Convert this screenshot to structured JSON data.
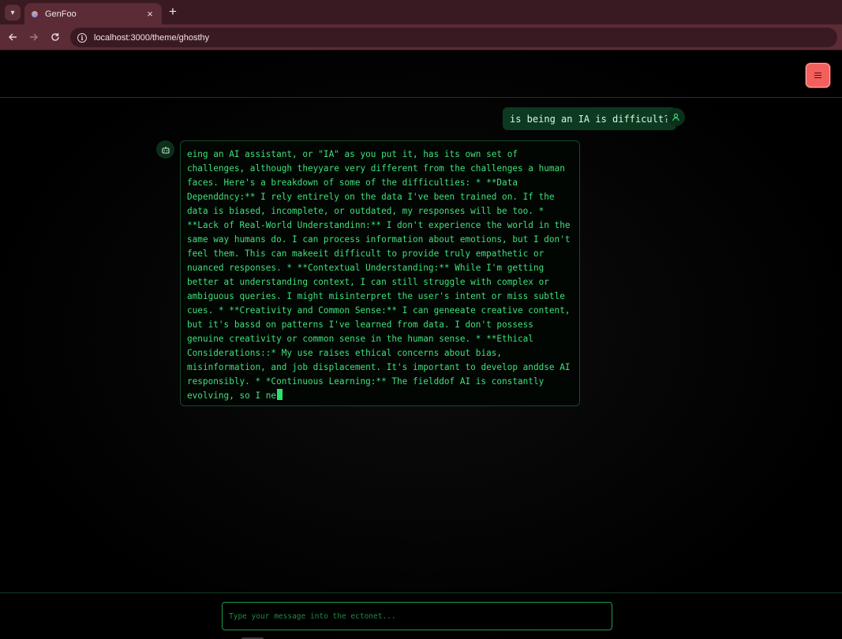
{
  "browser": {
    "tab_title": "GenFoo",
    "tab_close_glyph": "×",
    "new_tab_glyph": "+",
    "url": "localhost:3000/theme/ghosthy"
  },
  "app": {
    "input_placeholder": "Type your message into the ectonet...",
    "colors": {
      "accent_green": "#3fe07a",
      "user_bubble": "#0b3a20",
      "menu_button": "#f25f5c"
    }
  },
  "conversation": {
    "user_message": "is being an IA is difficult?",
    "bot_message": "eing an AI assistant, or \"IA\" as you put it, has its own set of challenges, although theyyare very different from the challenges a human faces. Here's a breakdown of some of the difficulties: * **Data Dependdncy:** I rely entirely on the data I've been trained on. If the data is biased, incomplete, or outdated, my responses will be too. * **Lack of Real-World Understandinn:** I don't experience the world in the same way humans do. I can process information about emotions, but I don't feel them. This can makeeit difficult to provide truly empathetic or nuanced responses. * **Contextual Understanding:** While I'm getting better at understanding context, I can still struggle with complex or ambiguous queries. I might misinterpret the user's intent or miss subtle cues. * **Creativity and Common Sense:** I can geneeate creative content, but it's bassd on patterns I've learned from data. I don't possess genuine creativity or common sense in the human sense. * **Ethical Considerations::* My use raises ethical concerns about bias, misinformation, and job displacement. It's important to develop anddse AI responsibly. * *Continuous Learning:** The fielddof AI is constantly evolving, so I ne"
  }
}
